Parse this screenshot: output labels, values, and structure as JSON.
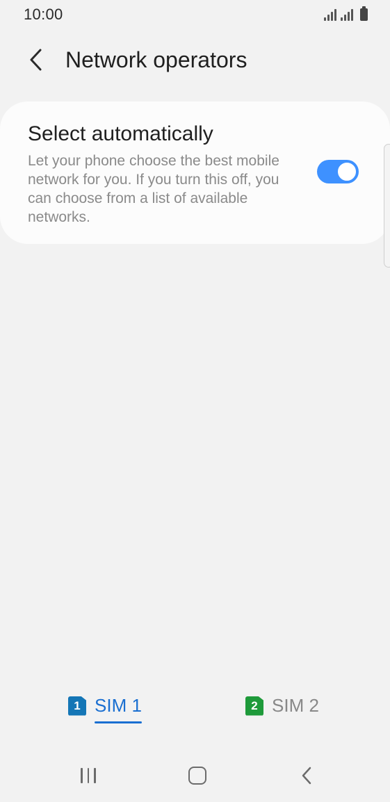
{
  "status_bar": {
    "time": "10:00",
    "icons": [
      "signal-icon",
      "signal-icon",
      "battery-icon"
    ]
  },
  "header": {
    "back_icon": "chevron-left-icon",
    "title": "Network operators"
  },
  "select_automatically": {
    "title": "Select automatically",
    "description": "Let your phone choose the best mobile network for you. If you turn this off, you can choose from a list of available networks.",
    "toggle_on": true
  },
  "sim_tabs": {
    "items": [
      {
        "badge": "1",
        "label": "SIM 1",
        "color": "#1a6fd1",
        "badge_color": "#1476b6",
        "active": true
      },
      {
        "badge": "2",
        "label": "SIM 2",
        "color": "#888888",
        "badge_color": "#1e9a3a",
        "active": false
      }
    ]
  },
  "nav_bar": {
    "recent_icon": "recent-apps-icon",
    "home_icon": "home-icon",
    "back_icon": "back-icon"
  },
  "colors": {
    "accent": "#3e91ff",
    "background": "#f2f2f2",
    "card": "#fcfcfc"
  }
}
